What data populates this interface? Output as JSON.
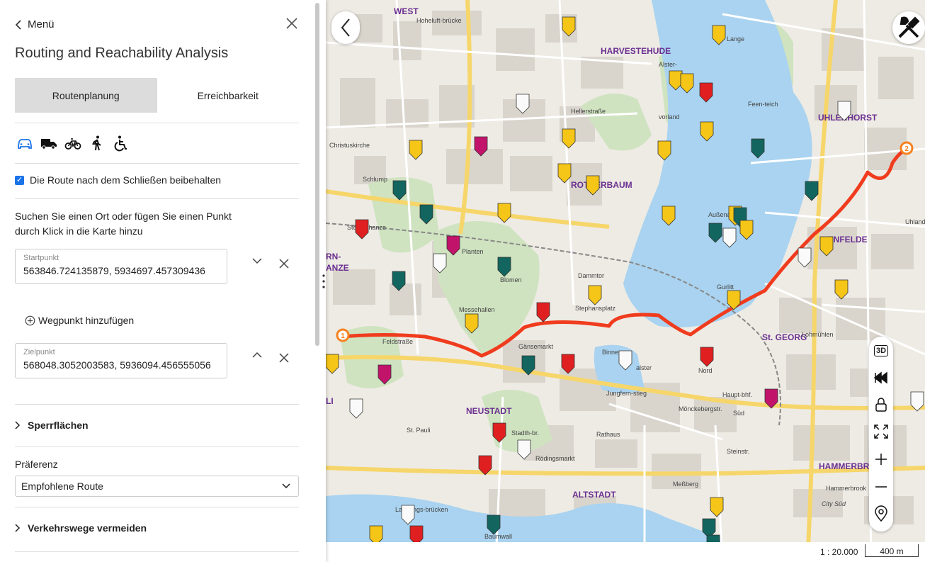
{
  "panel": {
    "back_label": "Menü",
    "title": "Routing and Reachability Analysis",
    "tabs": [
      {
        "label": "Routenplanung",
        "active": true
      },
      {
        "label": "Erreichbarkeit",
        "active": false
      }
    ],
    "modes": [
      "car-icon",
      "truck-icon",
      "bicycle-icon",
      "pedestrian-icon",
      "wheelchair-icon"
    ],
    "keep_route_label": "Die Route nach dem Schließen beibehalten",
    "keep_route_checked": true,
    "hint_line1": "Suchen Sie einen Ort oder fügen Sie einen Punkt",
    "hint_line2": "durch Klick in die Karte hinzu",
    "start": {
      "label": "Startpunkt",
      "value": "563846.724135879, 5934697.457309436"
    },
    "add_waypoint_label": "Wegpunkt hinzufügen",
    "end": {
      "label": "Zielpunkt",
      "value": "568048.3052003583, 5936094.456555056"
    },
    "sperrflaechen_label": "Sperrflächen",
    "preference_label": "Präferenz",
    "preference_value": "Empfohlene Route",
    "avoid_label": "Verkehrswege vermeiden"
  },
  "map": {
    "labels": [
      "WEST",
      "HARVESTEHUDE",
      "UHLENHORST",
      "ROTHERBAUM",
      "NEUSTADT",
      "ALTSTADT",
      "St. GEORG",
      "HAMMERBROOK",
      "HENFELDE",
      "RN-",
      "ANZE",
      "LI"
    ],
    "streets": [
      "Hoheluft-brücke",
      "Christuskirche",
      "Schlump",
      "Sternschanze",
      "Hellerstraße",
      "Außenalster",
      "Dammtor",
      "Stephansplatz",
      "Messehallen",
      "Gänsemarkt",
      "Feldstraße",
      "St. Pauli",
      "Jungfern-stieg",
      "Rathaus",
      "Mönckebergstr.",
      "Rödingsmarkt",
      "Meßberg",
      "Steinstr.",
      "Lohmühlen",
      "Hammerbrook",
      "City Süd",
      "Baumwall",
      "Landungs-brücken",
      "Planten",
      "Blomen",
      "Binnen-",
      "alster",
      "Haupt-bhf.",
      "Nord",
      "Süd",
      "Gurlitt",
      "Uhland",
      "Stadth-br.",
      "Feen-teich",
      "Alster-",
      "vorland",
      "Lange"
    ],
    "route_start_label": "1",
    "route_end_label": "2",
    "route_color": "#f03c1e",
    "toolbar": [
      "3D"
    ],
    "scale_text": "1 : 20.000",
    "scale_bar": "400 m"
  }
}
